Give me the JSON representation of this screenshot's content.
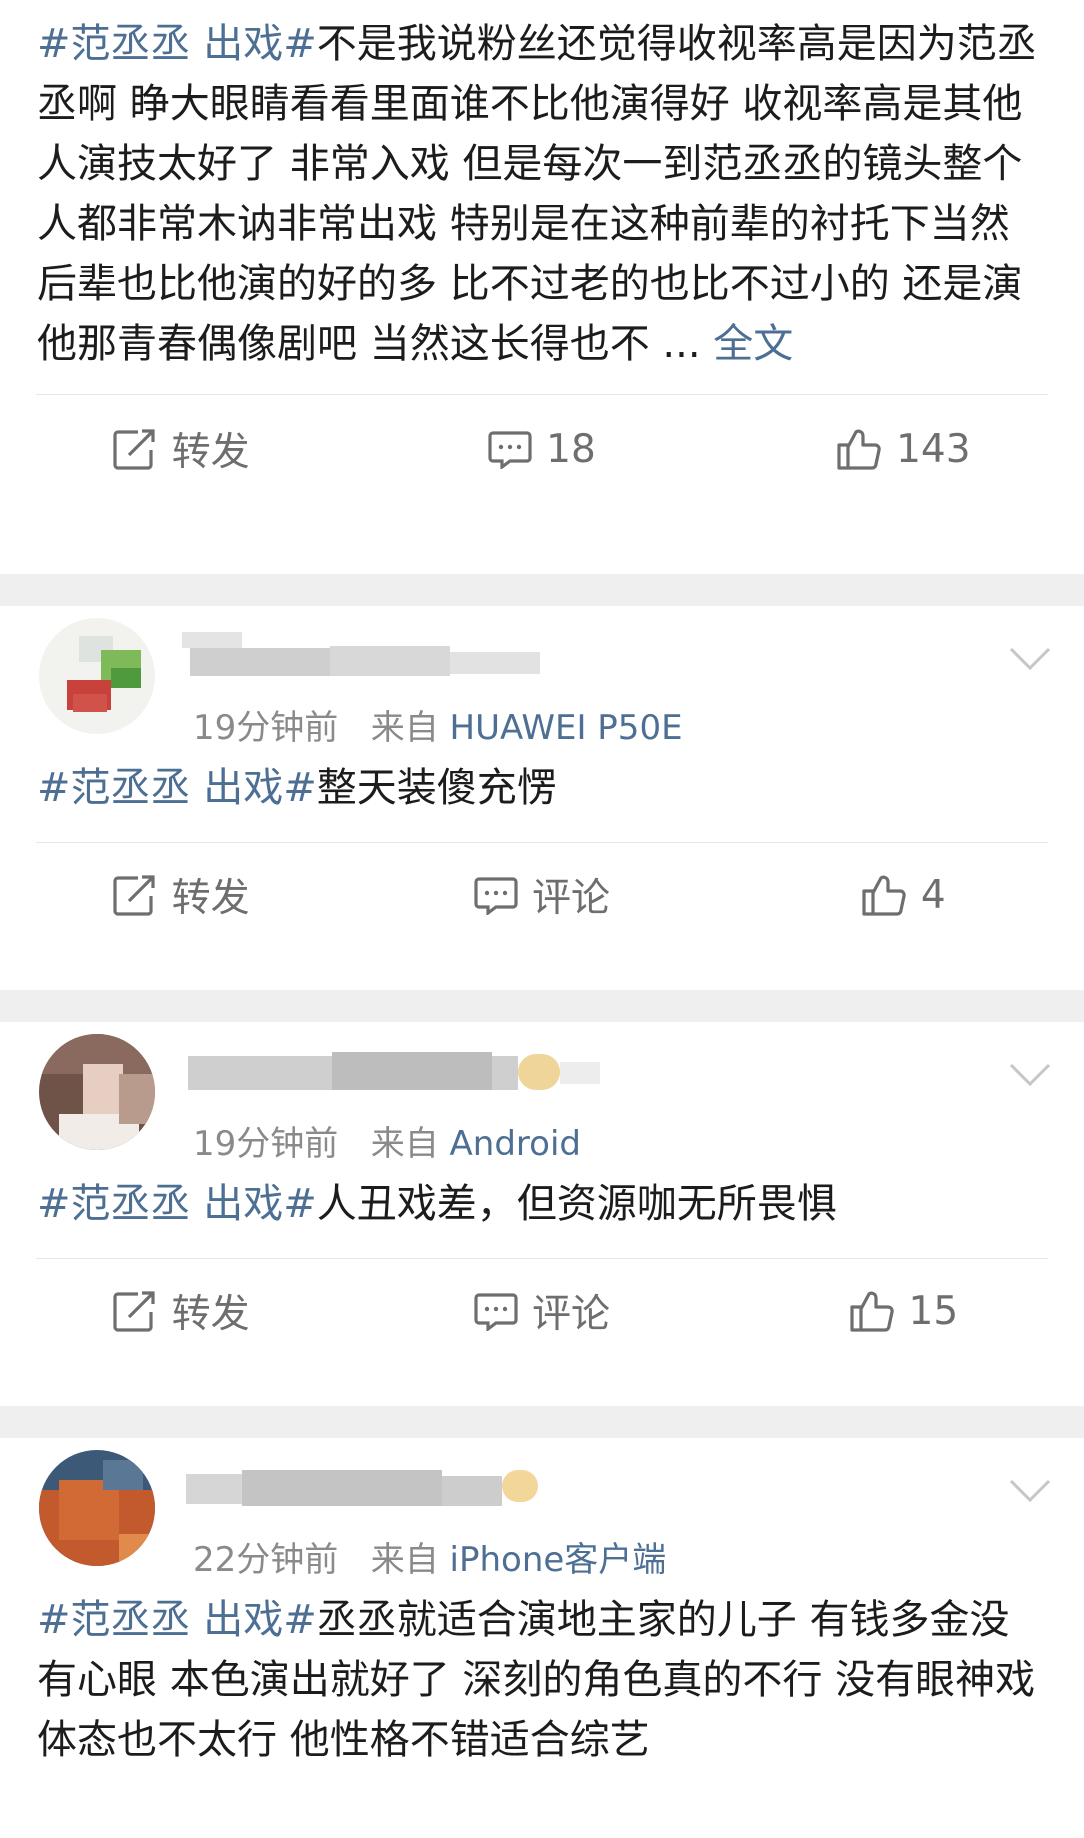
{
  "post": {
    "tag": "#范丞丞 出戏#",
    "text": "不是我说粉丝还觉得收视率高是因为范丞丞啊 睁大眼睛看看里面谁不比他演得好 收视率高是其他人演技太好了 非常入戏 但是每次一到范丞丞的镜头整个人都非常木讷非常出戏 特别是在这种前辈的衬托下当然后辈也比他演的好的多 比不过老的也比不过小的 还是演他那青春偶像剧吧 当然这长得也不 ...",
    "more": "全文",
    "repost_label": "转发",
    "comment_count": "18",
    "like_count": "143"
  },
  "comments": [
    {
      "time": "19分钟前",
      "from": "来自",
      "device": "HUAWEI P50E",
      "tag": "#范丞丞 出戏#",
      "text": "整天装傻充愣",
      "repost_label": "转发",
      "comment_label": "评论",
      "like_count": "4"
    },
    {
      "time": "19分钟前",
      "from": "来自",
      "device": "Android",
      "tag": "#范丞丞 出戏#",
      "text": "人丑戏差，但资源咖无所畏惧",
      "repost_label": "转发",
      "comment_label": "评论",
      "like_count": "15"
    },
    {
      "time": "22分钟前",
      "from": "来自",
      "device": "iPhone客户端",
      "tag": "#范丞丞 出戏#",
      "text": "丞丞就适合演地主家的儿子 有钱多金没有心眼 本色演出就好了 深刻的角色真的不行 没有眼神戏 体态也不太行 他性格不错适合综艺"
    }
  ],
  "colors": {
    "link": "#4d6f93",
    "meta": "#8a8a8a",
    "action": "#6e6e6e",
    "separator": "#efefef"
  },
  "icons": [
    "repost-icon",
    "comment-icon",
    "like-icon",
    "chevron-down-icon",
    "avatar"
  ]
}
